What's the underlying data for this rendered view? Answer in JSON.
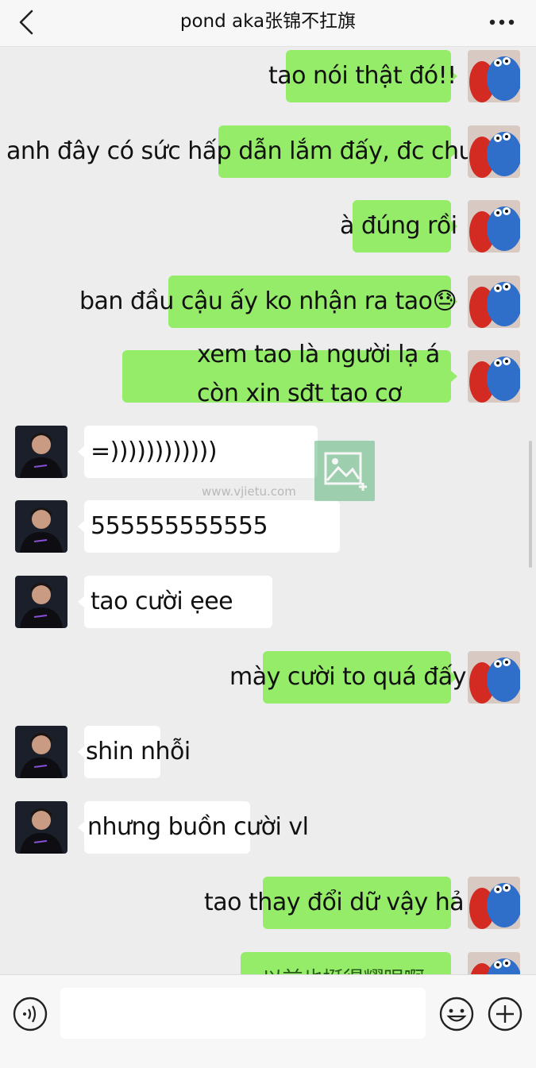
{
  "header": {
    "title": "pond aka张锦不扛旗",
    "back_icon": "chevron-left-icon",
    "more_icon": "more-dots-icon"
  },
  "messages": [
    {
      "side": "out",
      "text": "tao nói thật đó!!"
    },
    {
      "side": "out",
      "text": "anh đây có sức hấp dẫn lắm đấy, đc chưa"
    },
    {
      "side": "out",
      "text": "à đúng rồi"
    },
    {
      "side": "out",
      "text": "ban đầu cậu ấy ko nhận ra tao😓"
    },
    {
      "side": "out",
      "line1": "xem tao là người lạ á",
      "line2": "còn xin sđt tao cơ"
    },
    {
      "side": "in",
      "text": "=))))))))))))"
    },
    {
      "side": "in",
      "text": "555555555555"
    },
    {
      "side": "in",
      "text": "tao cười ẹee"
    },
    {
      "side": "out",
      "text": "mày cười to quá đấy"
    },
    {
      "side": "in",
      "text": "shin nhỗi"
    },
    {
      "side": "in",
      "text": "nhưng buồn cười vl"
    },
    {
      "side": "out",
      "text": "tao thay đổi dữ vậy hả"
    },
    {
      "side": "out",
      "text": "以前也挺得耀眼啊"
    }
  ],
  "watermark": {
    "text": "www.vjietu.com",
    "icon": "image-icon"
  },
  "inputbar": {
    "voice_icon": "voice-icon",
    "emoji_icon": "emoji-icon",
    "plus_icon": "plus-icon",
    "input_value": ""
  },
  "colors": {
    "outgoing_bubble": "#95ec69",
    "incoming_bubble": "#ffffff",
    "background": "#ededed"
  }
}
